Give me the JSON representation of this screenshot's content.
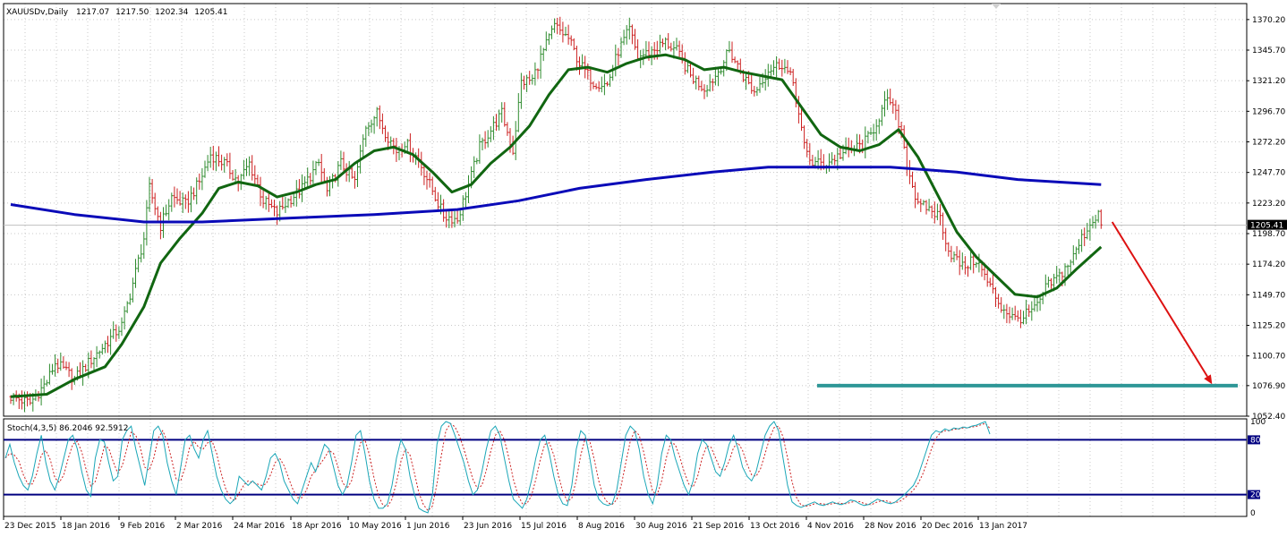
{
  "chart_data": [
    {
      "type": "candlestick",
      "panel": "price",
      "header": {
        "symbol": "XAUUSDv,Daily",
        "open": "1217.07",
        "high": "1217.50",
        "low": "1202.34",
        "close": "1205.41"
      },
      "ylim": [
        1052.4,
        1383.0
      ],
      "y_ticks": [
        "1370.20",
        "1345.70",
        "1321.20",
        "1296.70",
        "1272.20",
        "1247.70",
        "1223.20",
        "1198.70",
        "1174.20",
        "1149.70",
        "1125.20",
        "1100.70",
        "1076.90",
        "1052.40"
      ],
      "current_price": "1205.41",
      "x_labels": [
        "23 Dec 2015",
        "18 Jan 2016",
        "9 Feb 2016",
        "2 Mar 2016",
        "24 Mar 2016",
        "18 Apr 2016",
        "10 May 2016",
        "1 Jun 2016",
        "23 Jun 2016",
        "15 Jul 2016",
        "8 Aug 2016",
        "30 Aug 2016",
        "21 Sep 2016",
        "13 Oct 2016",
        "4 Nov 2016",
        "28 Nov 2016",
        "20 Dec 2016",
        "13 Jan 2017"
      ],
      "price_path": [
        [
          "2015-12-23",
          1068
        ],
        [
          "2015-12-30",
          1063
        ],
        [
          "2016-01-05",
          1080
        ],
        [
          "2016-01-08",
          1095
        ],
        [
          "2016-01-12",
          1088
        ],
        [
          "2016-01-15",
          1082
        ],
        [
          "2016-01-20",
          1095
        ],
        [
          "2016-01-26",
          1110
        ],
        [
          "2016-02-01",
          1125
        ],
        [
          "2016-02-04",
          1150
        ],
        [
          "2016-02-09",
          1195
        ],
        [
          "2016-02-11",
          1235
        ],
        [
          "2016-02-15",
          1205
        ],
        [
          "2016-02-19",
          1228
        ],
        [
          "2016-02-24",
          1222
        ],
        [
          "2016-02-29",
          1240
        ],
        [
          "2016-03-04",
          1262
        ],
        [
          "2016-03-09",
          1255
        ],
        [
          "2016-03-14",
          1240
        ],
        [
          "2016-03-18",
          1255
        ],
        [
          "2016-03-23",
          1225
        ],
        [
          "2016-03-28",
          1215
        ],
        [
          "2016-04-01",
          1225
        ],
        [
          "2016-04-06",
          1235
        ],
        [
          "2016-04-12",
          1255
        ],
        [
          "2016-04-15",
          1232
        ],
        [
          "2016-04-20",
          1255
        ],
        [
          "2016-04-25",
          1240
        ],
        [
          "2016-04-29",
          1285
        ],
        [
          "2016-05-03",
          1295
        ],
        [
          "2016-05-06",
          1280
        ],
        [
          "2016-05-10",
          1265
        ],
        [
          "2016-05-13",
          1272
        ],
        [
          "2016-05-18",
          1258
        ],
        [
          "2016-05-24",
          1228
        ],
        [
          "2016-05-27",
          1213
        ],
        [
          "2016-06-01",
          1210
        ],
        [
          "2016-06-06",
          1245
        ],
        [
          "2016-06-09",
          1268
        ],
        [
          "2016-06-14",
          1285
        ],
        [
          "2016-06-17",
          1295
        ],
        [
          "2016-06-21",
          1265
        ],
        [
          "2016-06-24",
          1320
        ],
        [
          "2016-06-28",
          1322
        ],
        [
          "2016-07-01",
          1340
        ],
        [
          "2016-07-06",
          1365
        ],
        [
          "2016-07-11",
          1355
        ],
        [
          "2016-07-15",
          1335
        ],
        [
          "2016-07-20",
          1320
        ],
        [
          "2016-07-25",
          1318
        ],
        [
          "2016-07-29",
          1345
        ],
        [
          "2016-08-02",
          1362
        ],
        [
          "2016-08-05",
          1340
        ],
        [
          "2016-08-10",
          1345
        ],
        [
          "2016-08-15",
          1352
        ],
        [
          "2016-08-19",
          1345
        ],
        [
          "2016-08-24",
          1325
        ],
        [
          "2016-08-29",
          1315
        ],
        [
          "2016-09-02",
          1325
        ],
        [
          "2016-09-07",
          1345
        ],
        [
          "2016-09-12",
          1325
        ],
        [
          "2016-09-16",
          1312
        ],
        [
          "2016-09-21",
          1330
        ],
        [
          "2016-09-26",
          1335
        ],
        [
          "2016-09-30",
          1320
        ],
        [
          "2016-10-04",
          1268
        ],
        [
          "2016-10-07",
          1255
        ],
        [
          "2016-10-12",
          1255
        ],
        [
          "2016-10-17",
          1262
        ],
        [
          "2016-10-20",
          1265
        ],
        [
          "2016-10-25",
          1270
        ],
        [
          "2016-10-28",
          1278
        ],
        [
          "2016-11-02",
          1302
        ],
        [
          "2016-11-04",
          1305
        ],
        [
          "2016-11-08",
          1282
        ],
        [
          "2016-11-10",
          1255
        ],
        [
          "2016-11-14",
          1220
        ],
        [
          "2016-11-17",
          1220
        ],
        [
          "2016-11-22",
          1212
        ],
        [
          "2016-11-25",
          1185
        ],
        [
          "2016-11-30",
          1172
        ],
        [
          "2016-12-05",
          1178
        ],
        [
          "2016-12-09",
          1160
        ],
        [
          "2016-12-14",
          1140
        ],
        [
          "2016-12-19",
          1130
        ],
        [
          "2016-12-22",
          1132
        ],
        [
          "2016-12-27",
          1140
        ],
        [
          "2016-12-30",
          1155
        ],
        [
          "2017-01-04",
          1165
        ],
        [
          "2017-01-09",
          1180
        ],
        [
          "2017-01-12",
          1195
        ],
        [
          "2017-01-16",
          1210
        ],
        [
          "2017-01-18",
          1215
        ],
        [
          "2017-01-19",
          1205.41
        ]
      ],
      "series": [
        {
          "indicator": "fast moving average",
          "color": "#116611",
          "points": [
            [
              "2015-12-23",
              1068
            ],
            [
              "2016-01-05",
              1070
            ],
            [
              "2016-01-15",
              1082
            ],
            [
              "2016-01-26",
              1092
            ],
            [
              "2016-02-01",
              1110
            ],
            [
              "2016-02-09",
              1140
            ],
            [
              "2016-02-15",
              1175
            ],
            [
              "2016-02-22",
              1195
            ],
            [
              "2016-03-01",
              1215
            ],
            [
              "2016-03-07",
              1235
            ],
            [
              "2016-03-14",
              1240
            ],
            [
              "2016-03-21",
              1237
            ],
            [
              "2016-03-28",
              1228
            ],
            [
              "2016-04-04",
              1232
            ],
            [
              "2016-04-11",
              1238
            ],
            [
              "2016-04-18",
              1242
            ],
            [
              "2016-04-25",
              1255
            ],
            [
              "2016-05-02",
              1265
            ],
            [
              "2016-05-09",
              1268
            ],
            [
              "2016-05-16",
              1262
            ],
            [
              "2016-05-23",
              1248
            ],
            [
              "2016-05-30",
              1232
            ],
            [
              "2016-06-06",
              1238
            ],
            [
              "2016-06-13",
              1255
            ],
            [
              "2016-06-20",
              1268
            ],
            [
              "2016-06-27",
              1285
            ],
            [
              "2016-07-04",
              1310
            ],
            [
              "2016-07-11",
              1330
            ],
            [
              "2016-07-18",
              1332
            ],
            [
              "2016-07-25",
              1328
            ],
            [
              "2016-08-01",
              1335
            ],
            [
              "2016-08-08",
              1340
            ],
            [
              "2016-08-15",
              1342
            ],
            [
              "2016-08-22",
              1338
            ],
            [
              "2016-08-29",
              1330
            ],
            [
              "2016-09-05",
              1332
            ],
            [
              "2016-09-12",
              1328
            ],
            [
              "2016-09-19",
              1325
            ],
            [
              "2016-09-26",
              1322
            ],
            [
              "2016-10-03",
              1300
            ],
            [
              "2016-10-10",
              1278
            ],
            [
              "2016-10-17",
              1268
            ],
            [
              "2016-10-24",
              1265
            ],
            [
              "2016-10-31",
              1270
            ],
            [
              "2016-11-07",
              1282
            ],
            [
              "2016-11-14",
              1260
            ],
            [
              "2016-11-21",
              1230
            ],
            [
              "2016-11-28",
              1200
            ],
            [
              "2016-12-05",
              1180
            ],
            [
              "2016-12-12",
              1165
            ],
            [
              "2016-12-19",
              1150
            ],
            [
              "2016-12-27",
              1148
            ],
            [
              "2017-01-03",
              1155
            ],
            [
              "2017-01-10",
              1170
            ],
            [
              "2017-01-19",
              1188
            ]
          ]
        },
        {
          "indicator": "slow moving average",
          "color": "#0a0ab8",
          "points": [
            [
              "2015-12-23",
              1222
            ],
            [
              "2016-01-15",
              1214
            ],
            [
              "2016-02-09",
              1208
            ],
            [
              "2016-03-01",
              1208
            ],
            [
              "2016-04-01",
              1211
            ],
            [
              "2016-05-02",
              1214
            ],
            [
              "2016-06-01",
              1218
            ],
            [
              "2016-06-23",
              1225
            ],
            [
              "2016-07-15",
              1235
            ],
            [
              "2016-08-08",
              1242
            ],
            [
              "2016-09-01",
              1248
            ],
            [
              "2016-09-21",
              1252
            ],
            [
              "2016-10-13",
              1252
            ],
            [
              "2016-11-04",
              1252
            ],
            [
              "2016-11-28",
              1248
            ],
            [
              "2016-12-20",
              1242
            ],
            [
              "2017-01-19",
              1238
            ]
          ]
        }
      ],
      "target_level": 1076.9,
      "target_line_color": "#2e9797",
      "forecast_arrow": {
        "from": [
          "2017-01-23",
          1208
        ],
        "to": [
          "2017-02-28",
          1078
        ],
        "color": "#dd1111"
      }
    },
    {
      "type": "line",
      "panel": "stochastic",
      "label": "Stoch(4,3,5) 86.2046 92.5912",
      "ylim": [
        0,
        100
      ],
      "y_ticks": [
        "100",
        "80",
        "20",
        "0"
      ],
      "levels": [
        80,
        20
      ],
      "level_color": "#000080",
      "main_color": "#1aa6b7",
      "signal_color": "#cc2222",
      "values_main": [
        60,
        75,
        55,
        40,
        30,
        25,
        40,
        65,
        85,
        55,
        35,
        25,
        40,
        60,
        80,
        85,
        70,
        45,
        25,
        18,
        60,
        80,
        78,
        55,
        35,
        40,
        80,
        90,
        95,
        70,
        50,
        30,
        60,
        90,
        95,
        85,
        55,
        35,
        20,
        50,
        80,
        85,
        70,
        60,
        80,
        90,
        65,
        40,
        25,
        15,
        10,
        15,
        40,
        35,
        30,
        35,
        30,
        25,
        40,
        60,
        65,
        55,
        35,
        25,
        15,
        10,
        25,
        40,
        55,
        45,
        60,
        75,
        70,
        50,
        30,
        20,
        30,
        55,
        85,
        90,
        65,
        35,
        15,
        5,
        5,
        10,
        30,
        60,
        80,
        70,
        40,
        20,
        5,
        2,
        0,
        20,
        75,
        95,
        100,
        98,
        85,
        70,
        55,
        35,
        20,
        25,
        45,
        70,
        90,
        95,
        85,
        60,
        35,
        15,
        10,
        5,
        15,
        35,
        60,
        80,
        85,
        65,
        40,
        20,
        10,
        8,
        30,
        70,
        90,
        85,
        60,
        30,
        15,
        10,
        8,
        10,
        25,
        55,
        85,
        95,
        90,
        70,
        40,
        20,
        10,
        30,
        65,
        85,
        80,
        60,
        45,
        30,
        20,
        35,
        65,
        80,
        75,
        60,
        45,
        40,
        55,
        75,
        85,
        70,
        50,
        40,
        35,
        45,
        65,
        85,
        95,
        100,
        90,
        60,
        30,
        12,
        8,
        6,
        8,
        10,
        12,
        9,
        8,
        10,
        12,
        10,
        9,
        11,
        14,
        13,
        10,
        8,
        9,
        12,
        15,
        13,
        11,
        10,
        12,
        16,
        20,
        25,
        30,
        40,
        55,
        70,
        85,
        90,
        88,
        92,
        90,
        93,
        92,
        94,
        93,
        95,
        96,
        98,
        100,
        86.2
      ]
    }
  ]
}
